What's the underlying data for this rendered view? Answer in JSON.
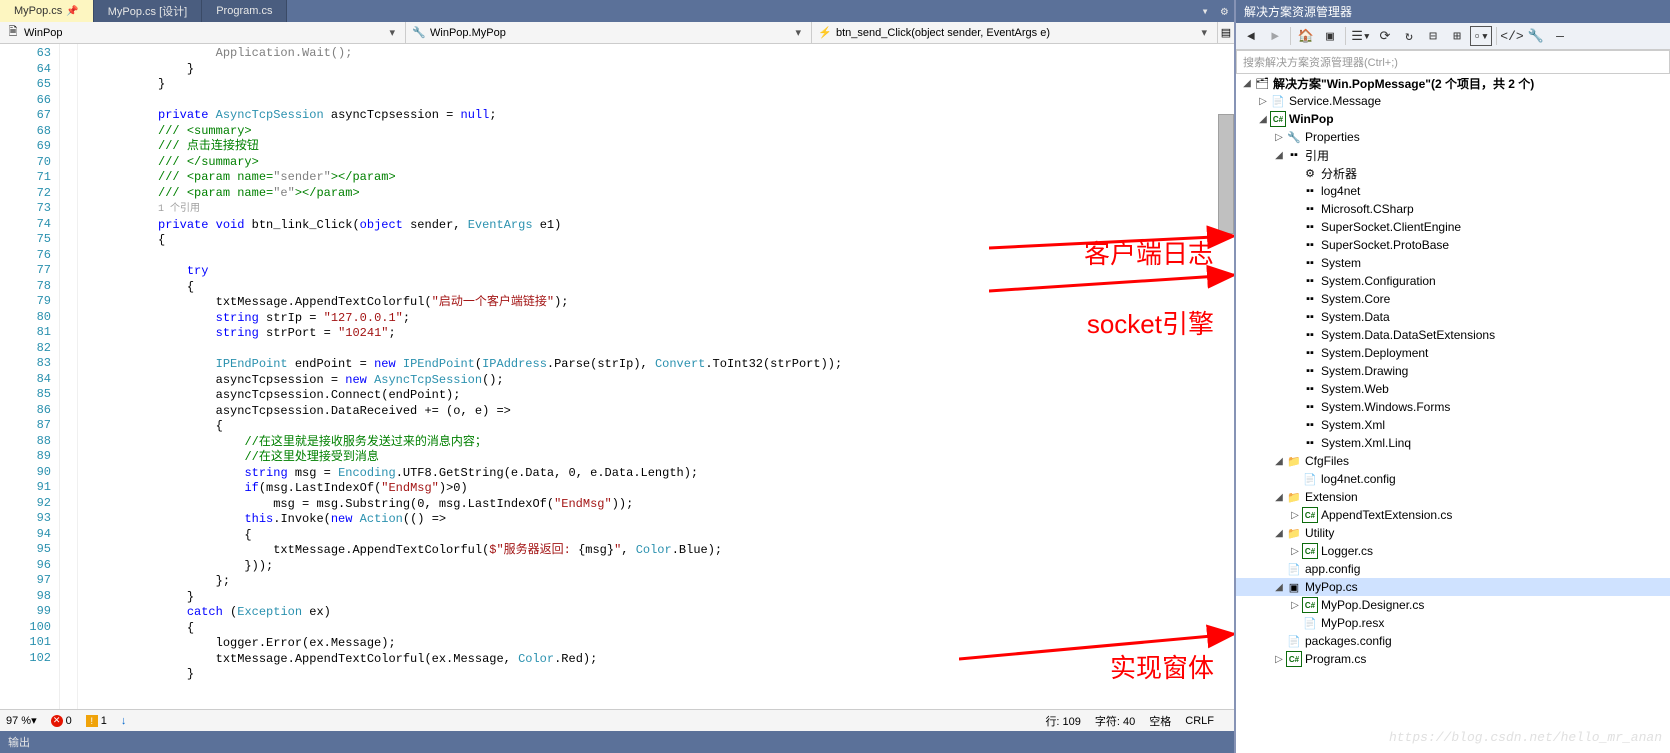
{
  "tabs": [
    {
      "label": "MyPop.cs",
      "active": true,
      "pinned": true
    },
    {
      "label": "MyPop.cs [设计]",
      "active": false
    },
    {
      "label": "Program.cs",
      "active": false
    }
  ],
  "nav": {
    "scope1": {
      "icon": "🗎",
      "icon_color": "#ae7e00",
      "label": "WinPop"
    },
    "scope2": {
      "icon": "🔧",
      "icon_color": "#ae7e00",
      "label": "WinPop.MyPop"
    },
    "scope3": {
      "icon": "⚡",
      "icon_color": "#b8860b",
      "label": "btn_send_Click(object sender, EventArgs e)"
    }
  },
  "code": {
    "lines": [
      {
        "n": 63,
        "html": "                  <span class=\"gray\">Application.Wait();</span>"
      },
      {
        "n": 64,
        "html": "              }"
      },
      {
        "n": 65,
        "html": "          }"
      },
      {
        "n": 66,
        "html": ""
      },
      {
        "n": 67,
        "html": "          <span class=\"kw\">private</span> <span class=\"type\">AsyncTcpSession</span> asyncTcpsession = <span class=\"kw\">null</span>;"
      },
      {
        "n": 68,
        "html": "          <span class=\"cmt\">/// &lt;summary&gt;</span>"
      },
      {
        "n": 69,
        "html": "          <span class=\"cmt\">/// 点击连接按钮</span>"
      },
      {
        "n": 70,
        "html": "          <span class=\"cmt\">/// &lt;/summary&gt;</span>"
      },
      {
        "n": 71,
        "html": "          <span class=\"cmt\">/// &lt;param name=</span><span class=\"gray\">\"sender\"</span><span class=\"cmt\">&gt;&lt;/param&gt;</span>"
      },
      {
        "n": 72,
        "html": "          <span class=\"cmt\">/// &lt;param name=</span><span class=\"gray\">\"e\"</span><span class=\"cmt\">&gt;&lt;/param&gt;</span>"
      },
      {
        "n": null,
        "html": "          <span class=\"ref-annotation\">1 个引用</span>"
      },
      {
        "n": 73,
        "html": "          <span class=\"kw\">private</span> <span class=\"kw\">void</span> btn_link_Click(<span class=\"kw\">object</span> sender, <span class=\"type\">EventArgs</span> e1)"
      },
      {
        "n": 74,
        "html": "          {"
      },
      {
        "n": 75,
        "html": ""
      },
      {
        "n": 76,
        "html": "              <span class=\"kw\">try</span>"
      },
      {
        "n": 77,
        "html": "              {"
      },
      {
        "n": 78,
        "html": "                  txtMessage.AppendTextColorful(<span class=\"str\">\"启动一个客户端链接\"</span>);"
      },
      {
        "n": 79,
        "html": "                  <span class=\"kw\">string</span> strIp = <span class=\"str\">\"127.0.0.1\"</span>;"
      },
      {
        "n": 80,
        "html": "                  <span class=\"kw\">string</span> strPort = <span class=\"str\">\"10241\"</span>;"
      },
      {
        "n": 81,
        "html": ""
      },
      {
        "n": 82,
        "html": "                  <span class=\"type\">IPEndPoint</span> endPoint = <span class=\"kw\">new</span> <span class=\"type\">IPEndPoint</span>(<span class=\"type\">IPAddress</span>.Parse(strIp), <span class=\"type\">Convert</span>.ToInt32(strPort));"
      },
      {
        "n": 83,
        "html": "                  asyncTcpsession = <span class=\"kw\">new</span> <span class=\"type\">AsyncTcpSession</span>();"
      },
      {
        "n": 84,
        "html": "                  asyncTcpsession.Connect(endPoint);"
      },
      {
        "n": 85,
        "html": "                  asyncTcpsession.DataReceived += (o, e) =&gt;"
      },
      {
        "n": 86,
        "html": "                  {"
      },
      {
        "n": 87,
        "html": "                      <span class=\"cmt\">//在这里就是接收服务发送过来的消息内容；</span>"
      },
      {
        "n": 88,
        "html": "                      <span class=\"cmt\">//在这里处理接受到消息</span>"
      },
      {
        "n": 89,
        "html": "                      <span class=\"kw\">string</span> msg = <span class=\"type\">Encoding</span>.UTF8.GetString(e.Data, 0, e.Data.Length);"
      },
      {
        "n": 90,
        "html": "                      <span class=\"kw\">if</span>(msg.LastIndexOf(<span class=\"str\">\"EndMsg\"</span>)&gt;0)"
      },
      {
        "n": 91,
        "html": "                          msg = msg.Substring(0, msg.LastIndexOf(<span class=\"str\">\"EndMsg\"</span>));"
      },
      {
        "n": 92,
        "html": "                      <span class=\"kw\">this</span>.Invoke(<span class=\"kw\">new</span> <span class=\"type\">Action</span>(() =&gt;"
      },
      {
        "n": 93,
        "html": "                      {"
      },
      {
        "n": 94,
        "html": "                          txtMessage.AppendTextColorful(<span class=\"str\">$\"服务器返回: </span>{msg}<span class=\"str\">\"</span>, <span class=\"type\">Color</span>.Blue);"
      },
      {
        "n": 95,
        "html": "                      }));"
      },
      {
        "n": 96,
        "html": "                  };"
      },
      {
        "n": 97,
        "html": "              }"
      },
      {
        "n": 98,
        "html": "              <span class=\"kw\">catch</span> (<span class=\"type\">Exception</span> ex)"
      },
      {
        "n": 99,
        "html": "              {"
      },
      {
        "n": 100,
        "html": "                  logger.Error(ex.Message);"
      },
      {
        "n": 101,
        "html": "                  txtMessage.AppendTextColorful(ex.Message, <span class=\"type\">Color</span>.Red);"
      },
      {
        "n": 102,
        "html": "              }"
      }
    ]
  },
  "status": {
    "zoom": "97 %",
    "errors": "0",
    "warnings": "1",
    "line_label": "行: 109",
    "char_label": "字符: 40",
    "space_label": "空格",
    "ending": "CRLF"
  },
  "output_label": "输出",
  "sidebar": {
    "title": "解决方案资源管理器",
    "search_placeholder": "搜索解决方案资源管理器(Ctrl+;)",
    "solution_label": "解决方案\"Win.PopMessage\"(2 个项目，共 2 个)",
    "tree": [
      {
        "level": 1,
        "exp": "▷",
        "icon": "📄",
        "label": "Service.Message"
      },
      {
        "level": 1,
        "exp": "◢",
        "icon": "C#",
        "iconColor": "#0c6b0c",
        "label": "WinPop",
        "bold": true
      },
      {
        "level": 2,
        "exp": "▷",
        "icon": "🔧",
        "label": "Properties"
      },
      {
        "level": 2,
        "exp": "◢",
        "icon": "▪▪",
        "label": "引用"
      },
      {
        "level": 3,
        "exp": "",
        "icon": "⚙",
        "label": "分析器"
      },
      {
        "level": 3,
        "exp": "",
        "icon": "▪▪",
        "label": "log4net"
      },
      {
        "level": 3,
        "exp": "",
        "icon": "▪▪",
        "label": "Microsoft.CSharp"
      },
      {
        "level": 3,
        "exp": "",
        "icon": "▪▪",
        "label": "SuperSocket.ClientEngine"
      },
      {
        "level": 3,
        "exp": "",
        "icon": "▪▪",
        "label": "SuperSocket.ProtoBase"
      },
      {
        "level": 3,
        "exp": "",
        "icon": "▪▪",
        "label": "System"
      },
      {
        "level": 3,
        "exp": "",
        "icon": "▪▪",
        "label": "System.Configuration"
      },
      {
        "level": 3,
        "exp": "",
        "icon": "▪▪",
        "label": "System.Core"
      },
      {
        "level": 3,
        "exp": "",
        "icon": "▪▪",
        "label": "System.Data"
      },
      {
        "level": 3,
        "exp": "",
        "icon": "▪▪",
        "label": "System.Data.DataSetExtensions"
      },
      {
        "level": 3,
        "exp": "",
        "icon": "▪▪",
        "label": "System.Deployment"
      },
      {
        "level": 3,
        "exp": "",
        "icon": "▪▪",
        "label": "System.Drawing"
      },
      {
        "level": 3,
        "exp": "",
        "icon": "▪▪",
        "label": "System.Web"
      },
      {
        "level": 3,
        "exp": "",
        "icon": "▪▪",
        "label": "System.Windows.Forms"
      },
      {
        "level": 3,
        "exp": "",
        "icon": "▪▪",
        "label": "System.Xml"
      },
      {
        "level": 3,
        "exp": "",
        "icon": "▪▪",
        "label": "System.Xml.Linq"
      },
      {
        "level": 2,
        "exp": "◢",
        "icon": "📁",
        "label": "CfgFiles"
      },
      {
        "level": 3,
        "exp": "",
        "icon": "📄",
        "label": "log4net.config"
      },
      {
        "level": 2,
        "exp": "◢",
        "icon": "📁",
        "label": "Extension"
      },
      {
        "level": 3,
        "exp": "▷",
        "icon": "C#",
        "iconColor": "#0c6b0c",
        "label": "AppendTextExtension.cs"
      },
      {
        "level": 2,
        "exp": "◢",
        "icon": "📁",
        "label": "Utility"
      },
      {
        "level": 3,
        "exp": "▷",
        "icon": "C#",
        "iconColor": "#0c6b0c",
        "label": "Logger.cs"
      },
      {
        "level": 2,
        "exp": "",
        "icon": "📄",
        "label": "app.config"
      },
      {
        "level": 2,
        "exp": "◢",
        "icon": "▣",
        "label": "MyPop.cs",
        "sel": true
      },
      {
        "level": 3,
        "exp": "▷",
        "icon": "C#",
        "iconColor": "#0c6b0c",
        "label": "MyPop.Designer.cs"
      },
      {
        "level": 3,
        "exp": "",
        "icon": "📄",
        "label": "MyPop.resx"
      },
      {
        "level": 2,
        "exp": "",
        "icon": "📄",
        "label": "packages.config"
      },
      {
        "level": 2,
        "exp": "▷",
        "icon": "C#",
        "iconColor": "#0c6b0c",
        "label": "Program.cs"
      }
    ]
  },
  "annotations": {
    "a1": "客户端日志",
    "a2": "socket引擎",
    "a3": "实现窗体"
  },
  "watermark": "https://blog.csdn.net/hello_mr_anan"
}
